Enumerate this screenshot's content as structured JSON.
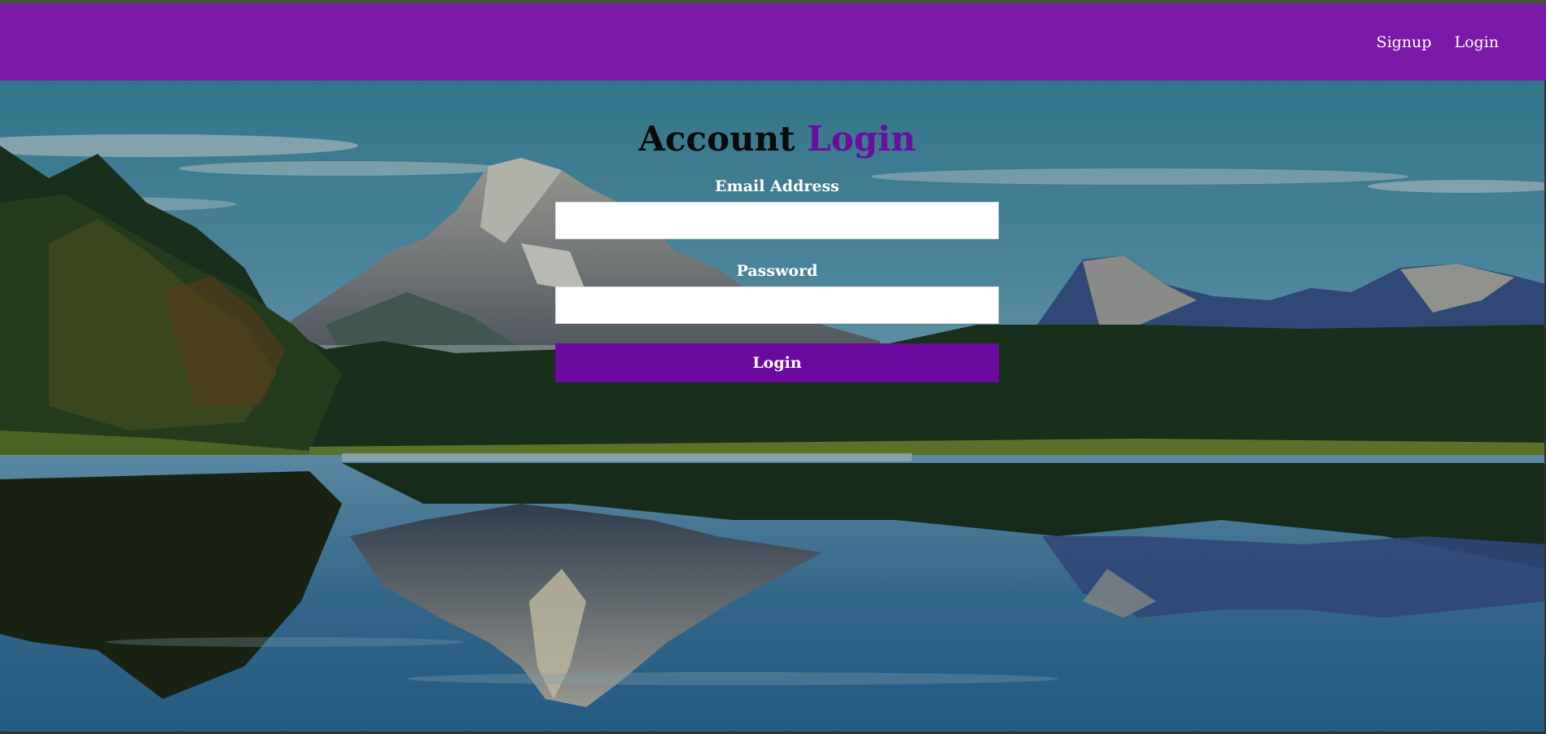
{
  "nav": {
    "links": [
      {
        "label": "Signup"
      },
      {
        "label": "Login"
      }
    ]
  },
  "form": {
    "title_main": "Account",
    "title_accent": "Login",
    "email_label": "Email Address",
    "email_value": "",
    "password_label": "Password",
    "password_value": "",
    "submit_label": "Login"
  },
  "colors": {
    "navbar": "#7a19a8",
    "accent": "#6a0ea0",
    "button": "#6a0a9e"
  },
  "background": {
    "description_icon": "mountain-lake-landscape-image"
  }
}
